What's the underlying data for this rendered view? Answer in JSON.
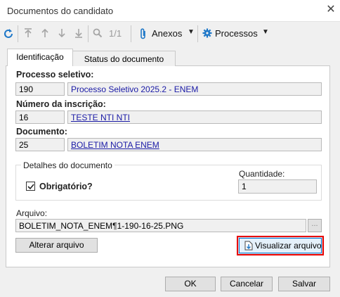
{
  "window": {
    "title": "Documentos do candidato",
    "close_glyph": "✕"
  },
  "toolbar": {
    "refresh_icon": "refresh-icon",
    "nav_icons": [
      "first-icon",
      "up-icon",
      "down-icon",
      "last-icon"
    ],
    "search_icon": "search-icon",
    "record_counter": "1/1",
    "anexos_label": "Anexos",
    "processos_label": "Processos",
    "caret": "▼",
    "accent_color": "#1f78c8"
  },
  "tabs": [
    {
      "label": "Identificação",
      "active": true
    },
    {
      "label": "Status do documento",
      "active": false
    }
  ],
  "form": {
    "processo": {
      "label": "Processo seletivo:",
      "code": "190",
      "name": "Processo Seletivo 2025.2 - ENEM"
    },
    "inscricao": {
      "label": "Número da inscrição:",
      "code": "16",
      "name": "TESTE NTI NTI"
    },
    "documento": {
      "label": "Documento:",
      "code": "25",
      "name": "BOLETIM NOTA ENEM"
    }
  },
  "detalhes": {
    "group_label": "Detalhes do documento",
    "obrigatorio_label": "Obrigatório?",
    "obrigatorio_checked": true,
    "quantidade_label": "Quantidade:",
    "quantidade_value": "1"
  },
  "arquivo": {
    "label": "Arquivo:",
    "value": "BOLETIM_NOTA_ENEM¶1-190-16-25.PNG",
    "browse_label": "...",
    "alterar_label": "Alterar arquivo",
    "visualizar_label": "Visualizar arquivo",
    "highlight_color": "#e60000"
  },
  "footer": {
    "ok_label": "OK",
    "cancel_label": "Cancelar",
    "save_label": "Salvar"
  }
}
